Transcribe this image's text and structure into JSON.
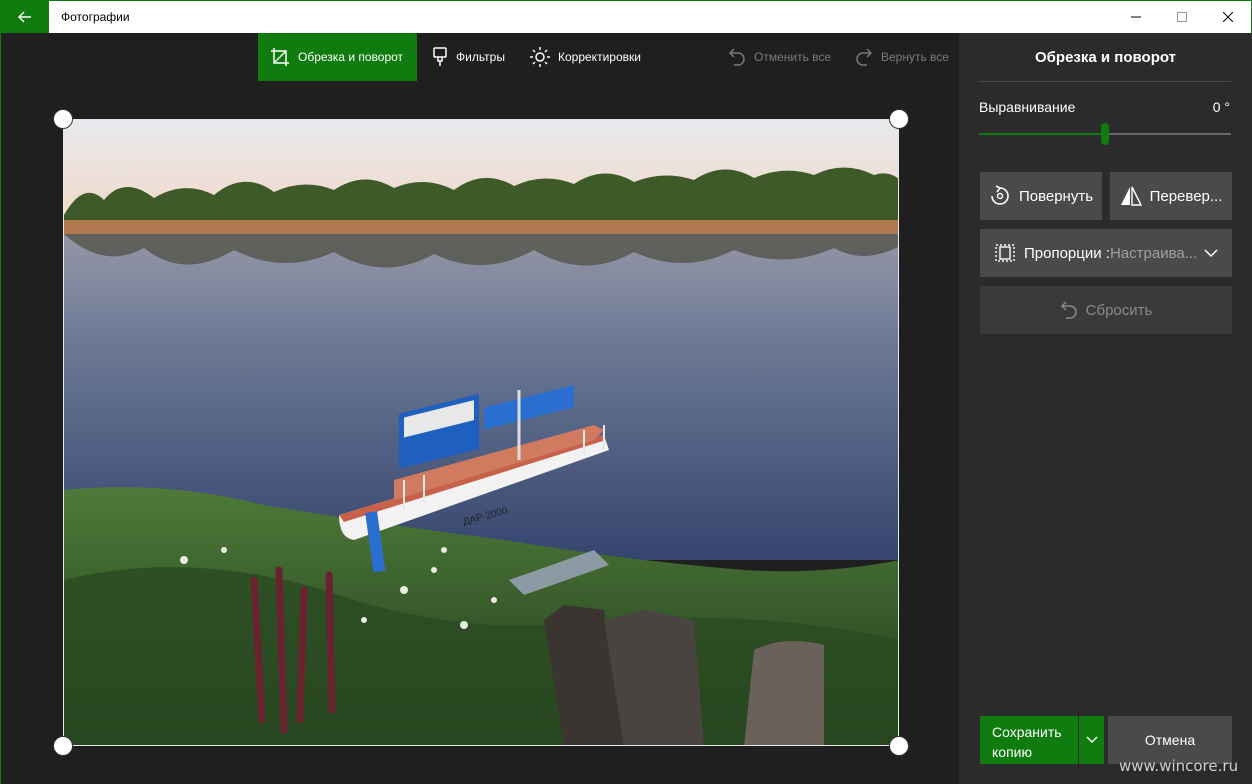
{
  "window": {
    "title": "Фотографии",
    "accent": "#107c10"
  },
  "toolbar": {
    "crop_label": "Обрезка и поворот",
    "filters_label": "Фильтры",
    "adjust_label": "Корректировки",
    "undo_all_label": "Отменить все",
    "redo_all_label": "Вернуть все"
  },
  "panel": {
    "title": "Обрезка и поворот",
    "straighten_label": "Выравнивание",
    "straighten_value": "0 °",
    "straighten_level_percent": 50,
    "rotate_label": "Повернуть",
    "flip_label": "Перевер...",
    "aspect_label": "Пропорции : ",
    "aspect_value": "Настраива...",
    "reset_label": "Сбросить",
    "save_label": "Сохранить копию",
    "cancel_label": "Отмена"
  },
  "photo": {
    "boat_name": "ДАР-2000"
  },
  "watermark": "www.wincore.ru"
}
